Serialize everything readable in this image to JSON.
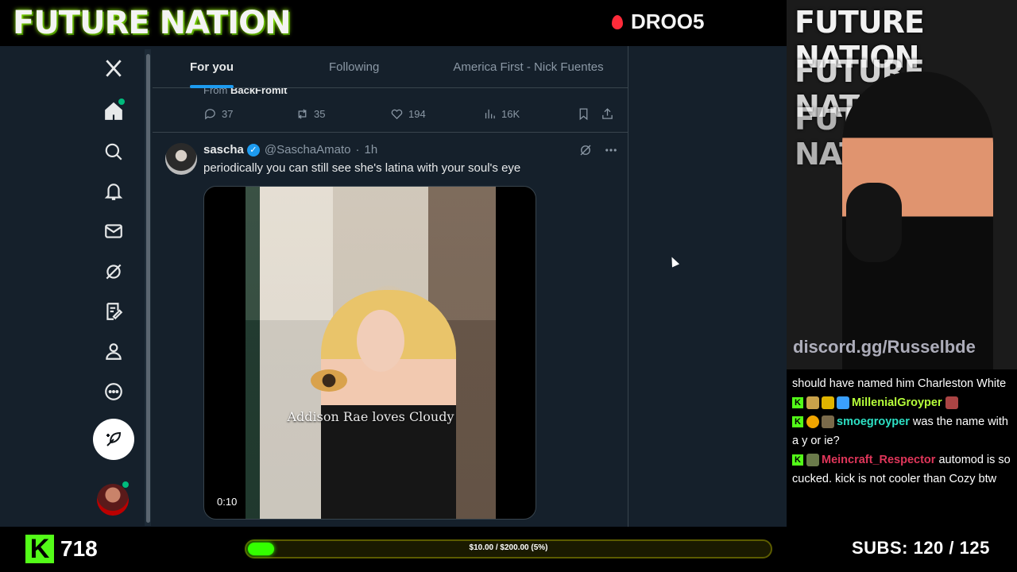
{
  "overlay": {
    "brand": "FUTURE NATION",
    "stream_code": "DROO5",
    "cam_title": "FUTURE NATION",
    "discord_text": "discord.gg/Russelbde",
    "viewers": "718",
    "goal_text": "$10.00 / $200.00 (5%)",
    "goal_percent": 5,
    "subs_label": "SUBS:",
    "subs_value": "120 / 125"
  },
  "tabs": [
    {
      "label": "For you",
      "active": true
    },
    {
      "label": "Following",
      "active": false
    },
    {
      "label": "America First - Nick Fuentes",
      "active": false
    }
  ],
  "prev_tweet": {
    "from_prefix": "From",
    "from_name": "BackFromIt",
    "replies": "37",
    "reposts": "35",
    "likes": "194",
    "views": "16K"
  },
  "tweet": {
    "name": "sascha",
    "handle": "@SaschaAmato",
    "time": "1h",
    "text": "periodically you can still see she's latina  with your soul's eye",
    "video_caption": "Addison Rae loves Cloudy",
    "video_time": "0:10"
  },
  "nav_icons": [
    "x-logo-icon",
    "home-icon",
    "search-icon",
    "bell-icon",
    "mail-icon",
    "grok-icon",
    "compose-list-icon",
    "profile-icon",
    "more-icon"
  ],
  "chat": [
    {
      "user": "",
      "text": "should have named him Charleston White"
    },
    {
      "user": "MillenialGroyper",
      "text": ""
    },
    {
      "user": "smoegroyper",
      "text": "was the name with a y or ie?"
    },
    {
      "user": "Meincraft_Respector",
      "text": "automod is so cucked. kick is not cooler than Cozy btw"
    }
  ],
  "colors": {
    "accent": "#1d9bf0",
    "kick_green": "#53fc18",
    "bg": "#15202b"
  }
}
